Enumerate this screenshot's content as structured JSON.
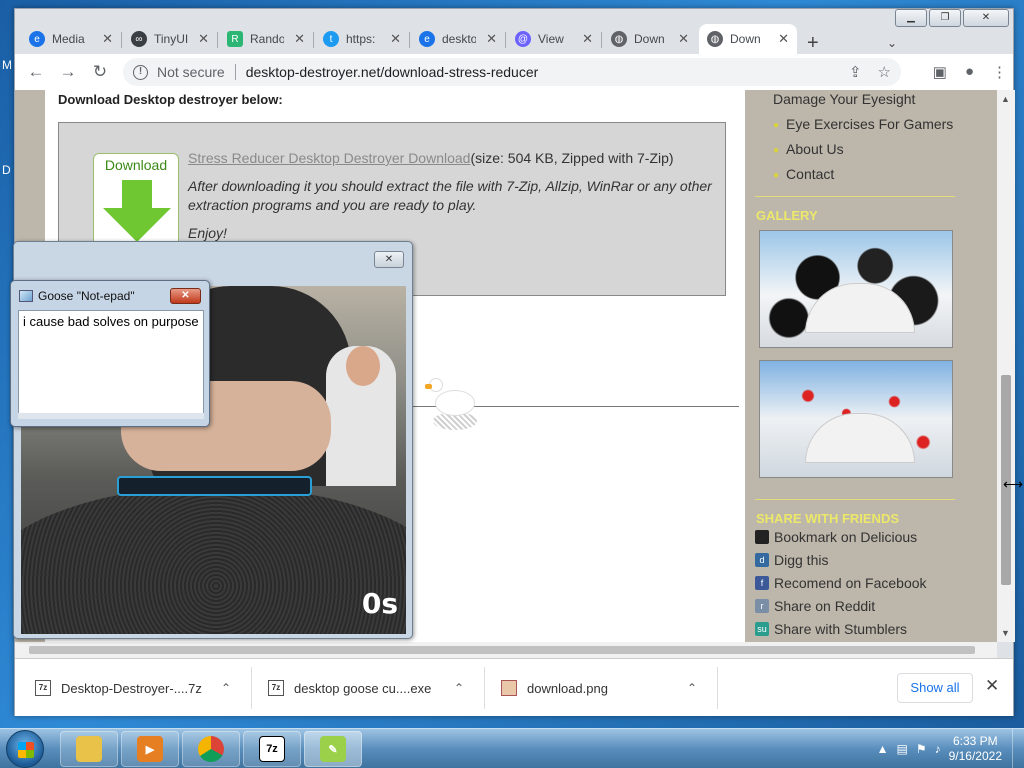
{
  "desktop": {
    "fragments": [
      "M",
      "D"
    ]
  },
  "browser": {
    "tabs": [
      {
        "title": "Media",
        "icon": "edge-icon",
        "color": "#1a73e8"
      },
      {
        "title": "TinyUI",
        "icon": "link-icon",
        "color": "#3a3f44"
      },
      {
        "title": "Rando",
        "icon": "r-logo-icon",
        "color": "#2bb673"
      },
      {
        "title": "https:",
        "icon": "twitter-icon",
        "color": "#1d9bf0"
      },
      {
        "title": "deskto",
        "icon": "edge-icon",
        "color": "#1a73e8"
      },
      {
        "title": "View",
        "icon": "at-icon",
        "color": "#6c63ff"
      },
      {
        "title": "Down",
        "icon": "globe-icon",
        "color": "#5f6368"
      },
      {
        "title": "Down",
        "icon": "globe-icon",
        "color": "#5f6368"
      }
    ],
    "address": {
      "security": "Not secure",
      "url": "desktop-destroyer.net/download-stress-reducer"
    }
  },
  "page": {
    "heading": "Download Desktop destroyer below:",
    "download_box": {
      "icon_label": "Download",
      "link": "Stress Reducer Desktop Destroyer Download",
      "size": "(size: 504 KB,  Zipped with 7-Zip)",
      "instructions": "After downloading it you should extract the file with 7-Zip, Allzip, WinRar or any other extraction programs and you are ready to play.",
      "enjoy": "Enjoy!"
    },
    "sidebar": {
      "nav": [
        "Damage Your Eyesight",
        "Eye Exercises For Gamers",
        "About Us",
        "Contact"
      ],
      "gallery_heading": "GALLERY",
      "share_heading": "SHARE WITH FRIENDS",
      "share": [
        {
          "label": "Bookmark on Delicious",
          "icon": "delicious-icon",
          "color": "#222"
        },
        {
          "label": "Digg this",
          "icon": "digg-icon",
          "color": "#356aa0"
        },
        {
          "label": "Recomend on Facebook",
          "icon": "facebook-icon",
          "color": "#3b5998"
        },
        {
          "label": "Share on Reddit",
          "icon": "reddit-icon",
          "color": "#7a8ea6"
        },
        {
          "label": "Share with Stumblers",
          "icon": "stumbleupon-icon",
          "color": "#2a9d8f"
        }
      ]
    }
  },
  "video_window": {
    "overlay_text": "0s"
  },
  "notepad": {
    "title": "Goose \"Not-epad\"",
    "body": "i cause bad solves on purpose"
  },
  "downloads": {
    "items": [
      {
        "name": "Desktop-Destroyer-....7z",
        "icon": "7z-file-icon"
      },
      {
        "name": "desktop goose cu....exe",
        "icon": "7z-file-icon"
      },
      {
        "name": "download.png",
        "icon": "image-file-icon"
      }
    ],
    "show_all": "Show all"
  },
  "taskbar": {
    "apps": [
      "explorer-icon",
      "media-player-icon",
      "chrome-icon",
      "7zip-icon",
      "goose-icon"
    ],
    "time": "6:33 PM",
    "date": "9/16/2022"
  }
}
